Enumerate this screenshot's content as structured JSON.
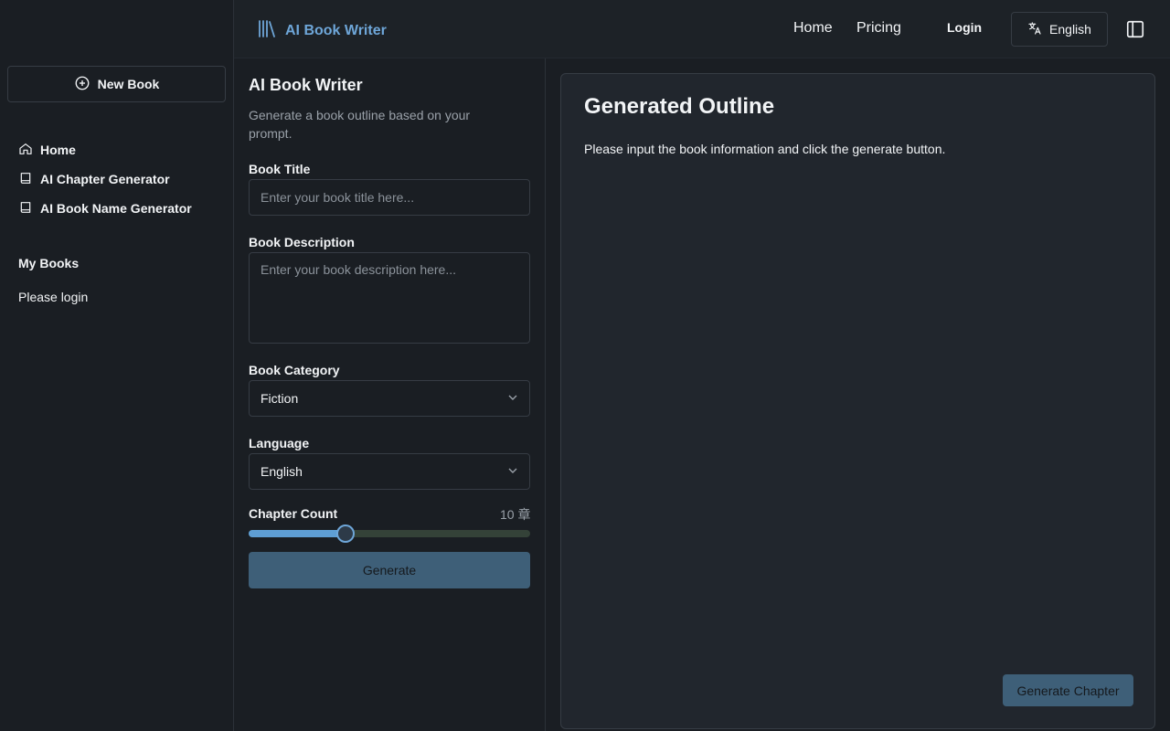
{
  "sidebar": {
    "new_book_label": "New Book",
    "items": [
      {
        "label": "Home",
        "icon": "home-icon"
      },
      {
        "label": "AI Chapter Generator",
        "icon": "book-icon"
      },
      {
        "label": "AI Book Name Generator",
        "icon": "book-icon"
      }
    ],
    "my_books_title": "My Books",
    "login_prompt": "Please login"
  },
  "header": {
    "brand": "AI Book Writer",
    "nav": [
      {
        "label": "Home"
      },
      {
        "label": "Pricing"
      }
    ],
    "login_label": "Login",
    "language_label": "English"
  },
  "form": {
    "title": "AI Book Writer",
    "subtitle": "Generate a book outline based on your prompt.",
    "book_title_label": "Book Title",
    "book_title_placeholder": "Enter your book title here...",
    "book_title_value": "",
    "description_label": "Book Description",
    "description_placeholder": "Enter your book description here...",
    "description_value": "",
    "category_label": "Book Category",
    "category_value": "Fiction",
    "language_label": "Language",
    "language_value": "English",
    "chapter_count_label": "Chapter Count",
    "chapter_count_display": "10 章",
    "chapter_count_fraction": 0.345,
    "generate_label": "Generate"
  },
  "output": {
    "title": "Generated Outline",
    "message": "Please input the book information and click the generate button.",
    "generate_chapter_label": "Generate Chapter"
  },
  "colors": {
    "accent": "#6ea6d8",
    "button_bg": "#3e5f78",
    "slider_track": "#344238",
    "slider_fill": "#5e9ed4"
  }
}
